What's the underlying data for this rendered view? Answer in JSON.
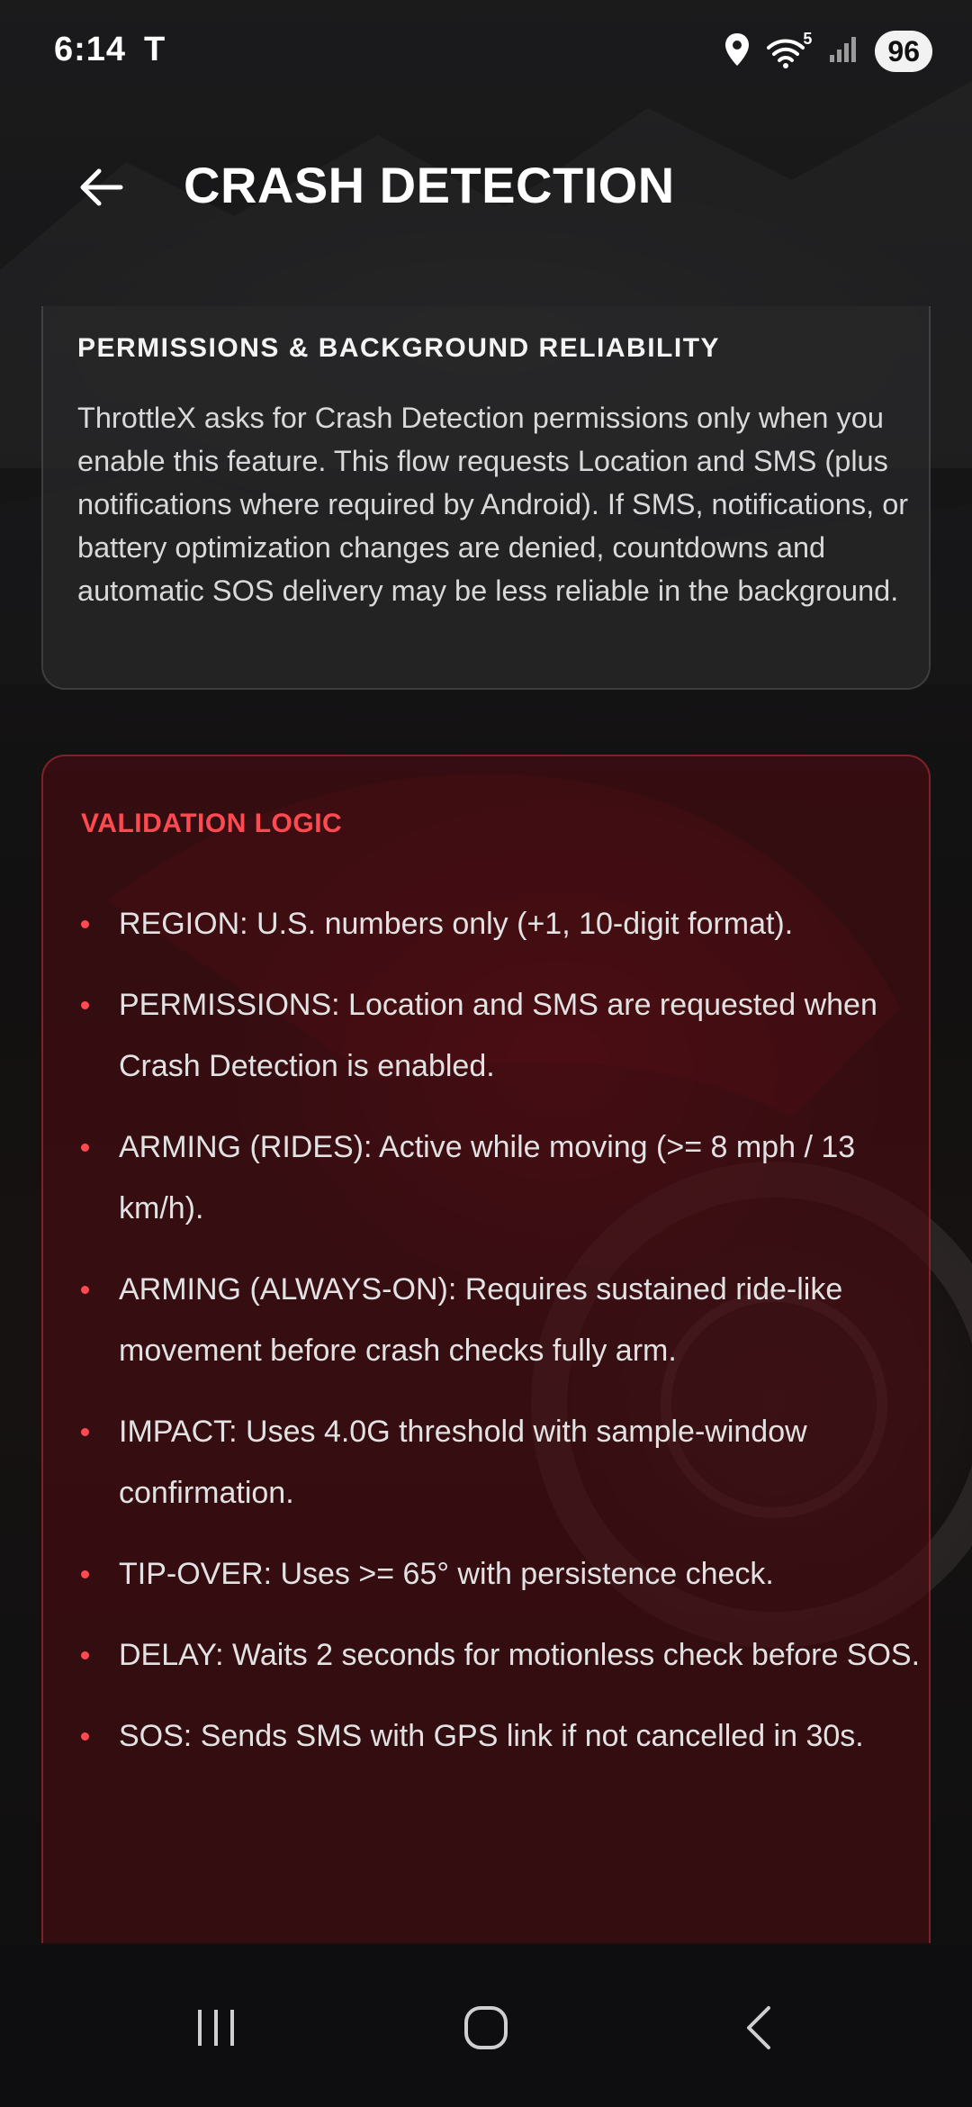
{
  "status_bar": {
    "time": "6:14",
    "carrier_glyph": "T",
    "battery": "96",
    "wifi_badge": "5",
    "icons": [
      "location-icon",
      "wifi-icon",
      "signal-icon"
    ]
  },
  "header": {
    "title": "CRASH DETECTION",
    "back_icon": "arrow-left-icon"
  },
  "permissions_card": {
    "title": "PERMISSIONS & BACKGROUND RELIABILITY",
    "body": "ThrottleX asks for Crash Detection permissions only when you enable this feature. This flow requests Location and SMS (plus notifications where required by Android). If SMS, notifications, or battery optimization changes are denied, countdowns and automatic SOS delivery may be less reliable in the background."
  },
  "validation_card": {
    "title": "VALIDATION LOGIC",
    "accent_color": "#ff4a52",
    "items": [
      "REGION: U.S. numbers only (+1, 10-digit format).",
      "PERMISSIONS: Location and SMS are requested when Crash Detection is enabled.",
      "ARMING (RIDES): Active while moving (>= 8 mph / 13 km/h).",
      "ARMING (ALWAYS-ON): Requires sustained ride-like movement before crash checks fully arm.",
      "IMPACT: Uses 4.0G threshold with sample-window confirmation.",
      "TIP-OVER: Uses >= 65° with persistence check.",
      "DELAY: Waits 2 seconds for motionless check before SOS.",
      "SOS: Sends SMS with GPS link if not cancelled in 30s."
    ]
  },
  "nav_bar": {
    "icons": [
      "recent-apps-icon",
      "home-icon",
      "back-icon"
    ]
  }
}
